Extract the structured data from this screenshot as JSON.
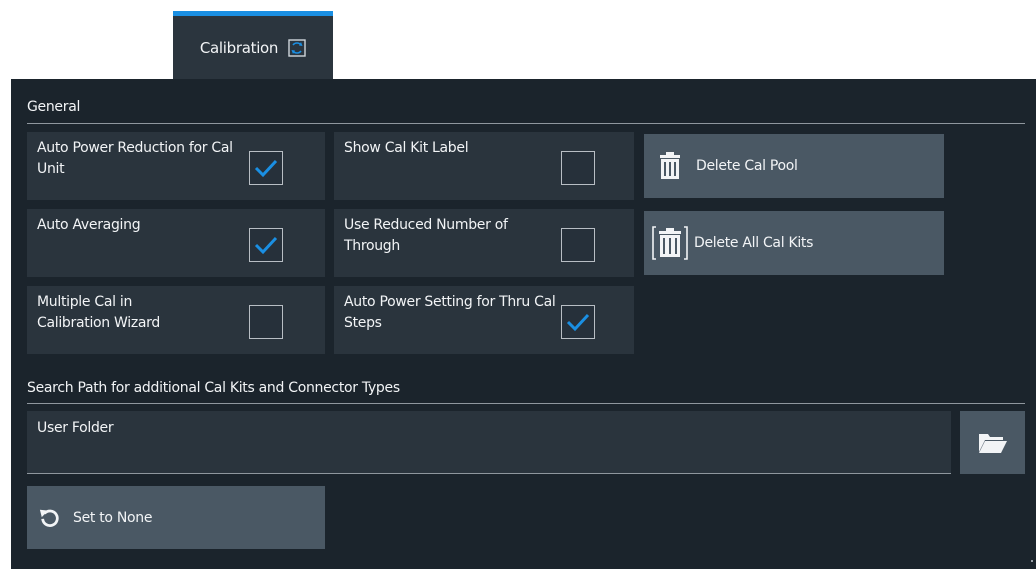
{
  "tab": {
    "label": "Calibration",
    "active": true,
    "accent_color": "#1a8fe3"
  },
  "general": {
    "title": "General",
    "options": [
      {
        "label": "Auto Power Reduction for Cal Unit",
        "checked": true
      },
      {
        "label": "Show Cal Kit Label",
        "checked": false
      },
      {
        "label": "Auto Averaging",
        "checked": true
      },
      {
        "label": "Use Reduced Number of Through",
        "checked": false
      },
      {
        "label": "Multiple Cal in Calibration Wizard",
        "checked": false
      },
      {
        "label": "Auto Power Setting for Thru Cal Steps",
        "checked": true
      }
    ],
    "buttons": {
      "delete_cal_pool": "Delete Cal Pool",
      "delete_all_cal_kits": "Delete All Cal Kits"
    }
  },
  "search_path": {
    "title": "Search Path for additional Cal Kits and Connector Types",
    "field_label": "User Folder",
    "field_value": "",
    "browse_icon": "folder-open-icon",
    "set_to_none": "Set to None"
  },
  "colors": {
    "panel_bg": "#1b242c",
    "tile_bg": "#2a343d",
    "button_bg": "#4a5864",
    "check_color": "#1a8fe3"
  }
}
